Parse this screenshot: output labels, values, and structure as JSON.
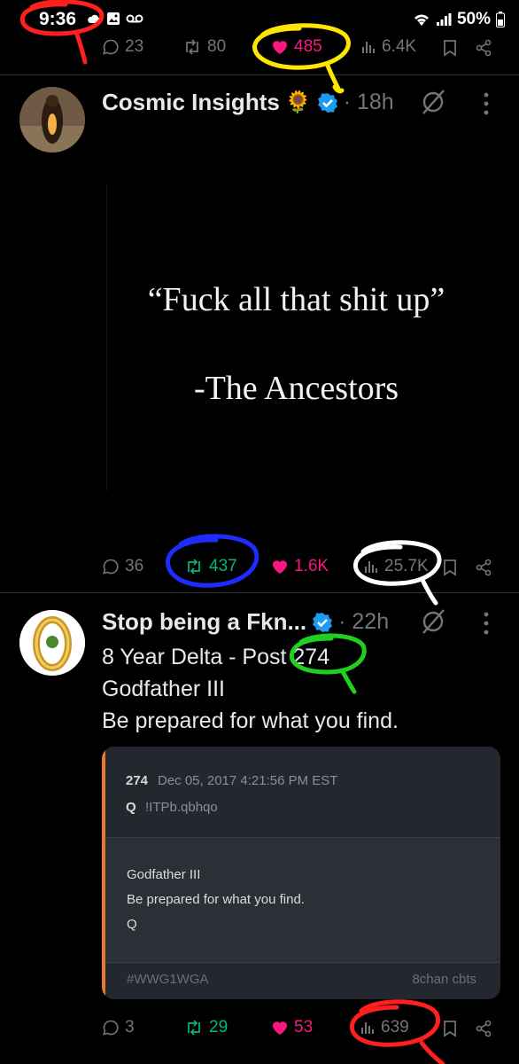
{
  "status_bar": {
    "time": "9:36",
    "battery": "50%"
  },
  "top_actions": {
    "replies": "23",
    "reposts": "80",
    "likes": "485",
    "views": "6.4K"
  },
  "post1": {
    "author": "Cosmic Insights",
    "author_emoji": "🌻",
    "time": "· 18h",
    "quote_line1": "“Fuck all that shit up”",
    "quote_line2": "-The Ancestors",
    "actions": {
      "replies": "36",
      "reposts": "437",
      "likes": "1.6K",
      "views": "25.7K"
    }
  },
  "post2": {
    "author": "Stop being a Fkn...",
    "time": "· 22h",
    "text_line1": "8 Year Delta - Post 274",
    "text_line2": "Godfather III",
    "text_line3": "Be prepared for what you find.",
    "card": {
      "post_number": "274",
      "date": "Dec 05, 2017 4:21:56 PM EST",
      "q": "Q",
      "trip": "!ITPb.qbhqo",
      "body_line1": "Godfather III",
      "body_line2": "Be prepared for what you find.",
      "body_line3": "Q",
      "hashtag": "#WWG1WGA",
      "source": "8chan cbts"
    },
    "actions": {
      "replies": "3",
      "reposts": "29",
      "likes": "53",
      "views": "639"
    }
  },
  "colors": {
    "like": "#f91880",
    "repost": "#00ba7c",
    "verified": "#1d9bf0",
    "muted": "#71767b"
  }
}
